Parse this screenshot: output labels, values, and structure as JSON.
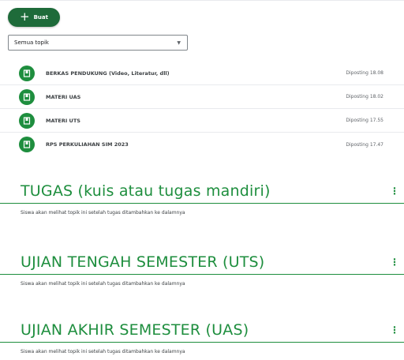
{
  "toolbar": {
    "create_label": "Buat",
    "topic_filter": "Semua topik"
  },
  "materials": [
    {
      "title": "BERKAS PENDUKUNG (Video, Literatur, dll)",
      "date": "Diposting 18.08"
    },
    {
      "title": "MATERI UAS",
      "date": "Diposting 18.02"
    },
    {
      "title": "MATERI UTS",
      "date": "Diposting 17.55"
    },
    {
      "title": "RPS PERKULIAHAN SIM 2023",
      "date": "Diposting 17.47"
    }
  ],
  "sections": [
    {
      "title": "TUGAS (kuis atau tugas mandiri)",
      "note": "Siswa akan melihat topik ini setelah tugas ditambahkan ke dalamnya"
    },
    {
      "title": "UJIAN TENGAH SEMESTER (UTS)",
      "note": "Siswa akan melihat topik ini setelah tugas ditambahkan ke dalamnya"
    },
    {
      "title": "UJIAN AKHIR SEMESTER (UAS)",
      "note": "Siswa akan melihat topik ini setelah tugas ditambahkan ke dalamnya"
    }
  ],
  "colors": {
    "accent": "#1e8e3e",
    "button": "#1e6b3a"
  }
}
